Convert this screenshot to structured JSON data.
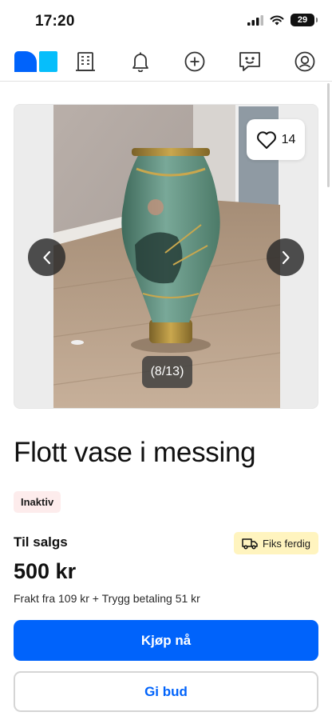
{
  "status_bar": {
    "time": "17:20",
    "battery": "29"
  },
  "navbar": {
    "items": [
      {
        "icon": "finn-logo-icon"
      },
      {
        "icon": "building-icon"
      },
      {
        "icon": "bell-icon"
      },
      {
        "icon": "add-circle-icon"
      },
      {
        "icon": "message-icon"
      },
      {
        "icon": "profile-icon"
      }
    ],
    "brand_color": "#0063fb"
  },
  "gallery": {
    "favorite_count": "14",
    "image_counter": "(8/13)"
  },
  "listing": {
    "title": "Flott vase i messing",
    "status_badge": "Inaktiv",
    "for_sale_label": "Til salgs",
    "fix_badge": "Fiks ferdig",
    "price": "500 kr",
    "shipping_text": "Frakt fra 109 kr + Trygg betaling 51 kr"
  },
  "actions": {
    "buy_label": "Kjøp nå",
    "bid_label": "Gi bud"
  },
  "colors": {
    "primary": "#0063fb",
    "inactive_badge_bg": "#fdecec",
    "fix_badge_bg": "#fff4bf"
  }
}
